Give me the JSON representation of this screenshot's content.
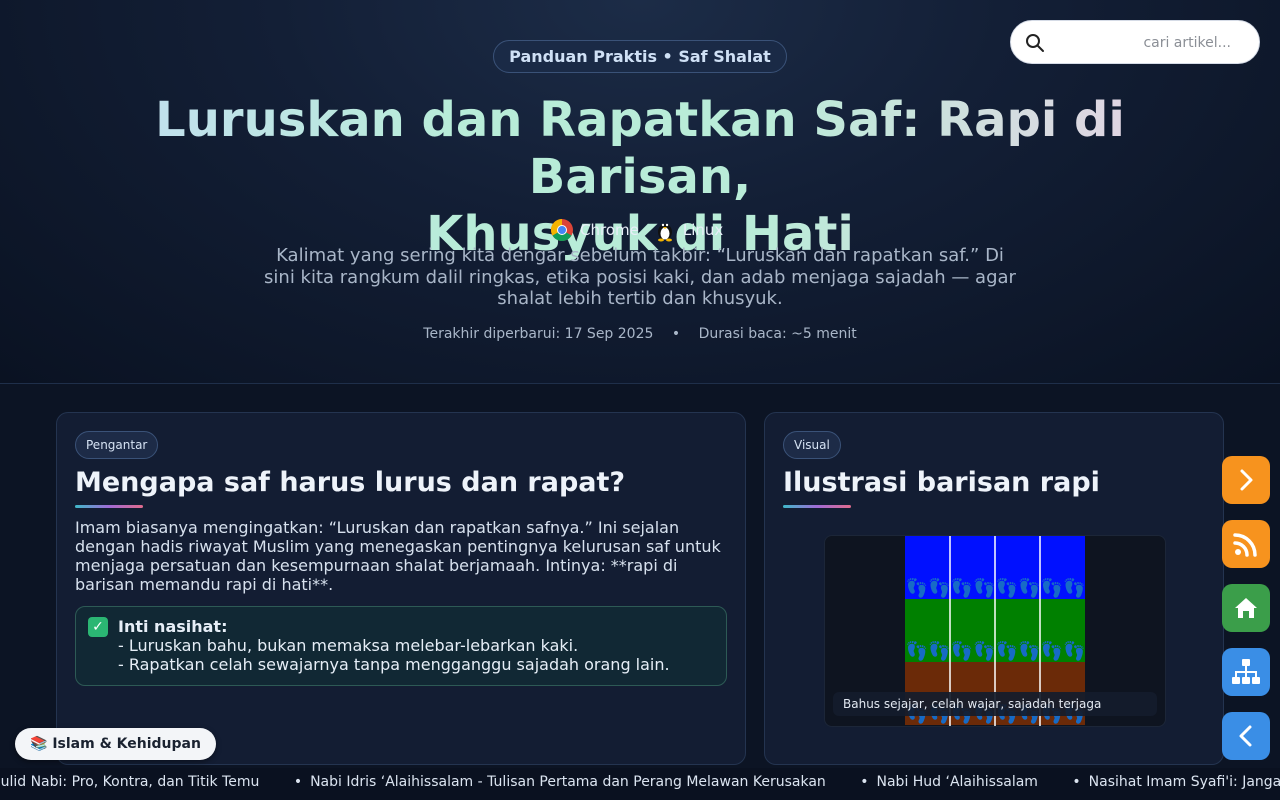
{
  "header": {
    "kicker": "Panduan Praktis • Saf Shalat",
    "title_line1": "Luruskan dan Rapatkan Saf: Rapi di Barisan,",
    "title_line2": "Khusyuk di Hati",
    "tech": [
      {
        "icon": "chrome-icon",
        "label": "Chrome"
      },
      {
        "icon": "linux-tux-icon",
        "label": "Linux"
      }
    ],
    "subtitle": "Kalimat yang sering kita dengar sebelum takbir: “Luruskan dan rapatkan saf.” Di sini kita rangkum dalil ringkas, etika posisi kaki, dan adab menjaga sajadah — agar shalat lebih tertib dan khusyuk.",
    "updated": "Terakhir diperbarui: 17 Sep 2025",
    "separator": "•",
    "read_time": "Durasi baca: ~5 menit"
  },
  "search": {
    "placeholder": "cari artikel...",
    "value": ""
  },
  "intro_card": {
    "tag": "Pengantar",
    "heading": "Mengapa saf harus lurus dan rapat?",
    "body": "Imam biasanya mengingatkan: “Luruskan dan rapatkan safnya.” Ini sejalan dengan hadis riwayat Muslim yang menegaskan pentingnya kelurusan saf untuk menjaga persatuan dan kesempurnaan shalat berjamaah. Intinya: **rapi di barisan memandu rapi di hati**.",
    "advice_title": "Inti nasihat:",
    "advice_lines": [
      "- Luruskan bahu, bukan memaksa melebar-lebarkan kaki.",
      "- Rapatkan celah sewajarnya tanpa mengganggu sajadah orang lain."
    ]
  },
  "visual_card": {
    "tag": "Visual",
    "heading": "Ilustrasi barisan rapi",
    "caption": "Bahus sejajar, celah wajar, sajadah terjaga",
    "row_colors": [
      "#0010ff",
      "#008000",
      "#6b2a08"
    ]
  },
  "category_chip": {
    "icon": "books-icon",
    "label": "📚 Islam & Kehidupan"
  },
  "fab_buttons": [
    {
      "icon": "chevron-right-icon",
      "color": "#f7931e"
    },
    {
      "icon": "rss-icon",
      "color": "#f7931e"
    },
    {
      "icon": "home-icon",
      "color": "#3b9e4a"
    },
    {
      "icon": "sitemap-icon",
      "color": "#3a8ee6"
    },
    {
      "icon": "chevron-left-icon",
      "color": "#3a8ee6"
    }
  ],
  "ticker": {
    "items": [
      "aulid Nabi: Pro, Kontra, dan Titik Temu",
      "Nabi Idris ‘Alaihissalam - Tulisan Pertama dan Perang Melawan Kerusakan",
      "Nabi Hud ‘Alaihissalam",
      "Nasihat Imam Syafi'i: Jangan Ti"
    ]
  }
}
